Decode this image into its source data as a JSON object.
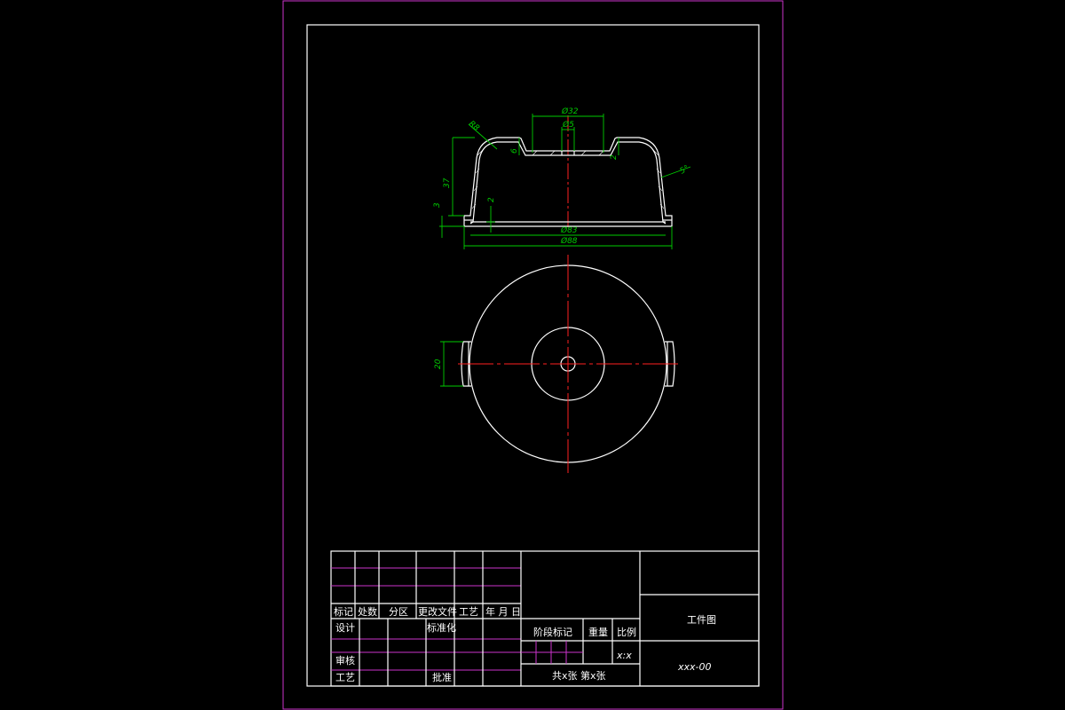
{
  "colors": {
    "background": "#000000",
    "sheet_border": "#cc33cc",
    "outline": "#ffffff",
    "centerline": "#ff2020",
    "dimension": "#00cc00"
  },
  "dimensions": {
    "d32": "Ø32",
    "d5": "Ø5",
    "r8": "R8",
    "h6": "6",
    "h2_top": "2",
    "angle": "5°",
    "h37": "37",
    "h3": "3",
    "h2_bottom": "2",
    "d83": "Ø83",
    "d88": "Ø88",
    "w20": "20"
  },
  "title_block": {
    "h_mark": "标记",
    "h_count": "处数",
    "h_zone": "分区",
    "h_docno": "更改文件",
    "h_craft": "工艺",
    "h_date": "年 月 日",
    "design": "设计",
    "standard": "标准化",
    "stage_mark": "阶段标记",
    "weight": "重量",
    "scale": "比例",
    "scale_value": "x:x",
    "review": "审核",
    "process": "工艺",
    "approve": "批准",
    "sheets": "共x张  第x张",
    "drawing_name": "工件图",
    "drawing_number": "xxx-00"
  }
}
